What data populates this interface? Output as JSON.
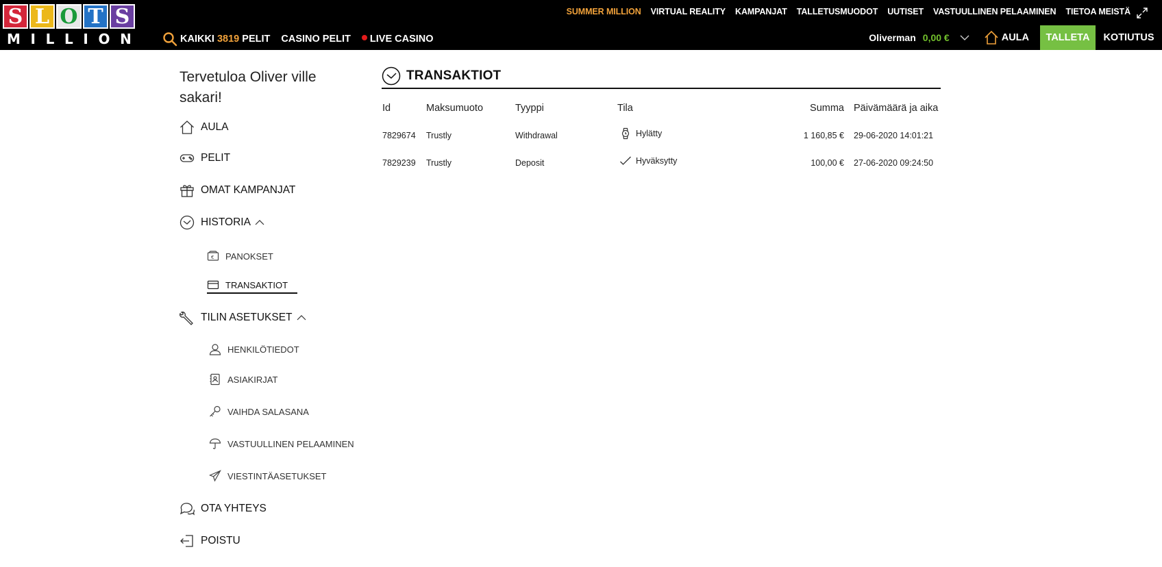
{
  "logo": {
    "tiles": [
      "S",
      "L",
      "O",
      "T",
      "S"
    ],
    "subtitle_letters": [
      "M",
      "I",
      "L",
      "L",
      "I",
      "O",
      "N"
    ]
  },
  "top_nav": {
    "items": [
      "SUMMER MILLION",
      "VIRTUAL REALITY",
      "KAMPANJAT",
      "TALLETUSMUODOT",
      "UUTISET",
      "VASTUULLINEN PELAAMINEN",
      "TIETOA MEISTÄ"
    ],
    "accent_color": "#f0a13a"
  },
  "main_nav": {
    "all_prefix": "KAIKKI",
    "game_count": "3819",
    "all_suffix": "PELIT",
    "casino": "CASINO PELIT",
    "live": "LIVE CASINO"
  },
  "account": {
    "username": "Oliverman",
    "balance": "0,00 €",
    "home_label": "AULA",
    "deposit_label": "TALLETA",
    "withdraw_label": "KOTIUTUS",
    "deposit_color": "#76c043"
  },
  "sidebar": {
    "welcome": "Tervetuloa Oliver ville sakari!",
    "items": {
      "aula": "AULA",
      "pelit": "PELIT",
      "kampanjat": "OMAT KAMPANJAT",
      "historia": "HISTORIA",
      "panokset": "PANOKSET",
      "transaktiot": "TRANSAKTIOT",
      "tilin": "TILIN ASETUKSET",
      "henkilotiedot": "HENKILÖTIEDOT",
      "asiakirjat": "ASIAKIRJAT",
      "salasana": "VAIHDA SALASANA",
      "vastuullinen": "VASTUULLINEN PELAAMINEN",
      "viestinta": "VIESTINTÄASETUKSET",
      "yhteys": "OTA YHTEYS",
      "poistu": "POISTU"
    }
  },
  "transactions": {
    "title": "TRANSAKTIOT",
    "headers": {
      "id": "Id",
      "method": "Maksumuoto",
      "type": "Tyyppi",
      "status": "Tila",
      "amount": "Summa",
      "datetime": "Päivämäärä ja aika"
    },
    "rows": [
      {
        "id": "7829674",
        "method": "Trustly",
        "type": "Withdrawal",
        "status": "Hylätty",
        "status_icon": "watch-icon",
        "amount": "1 160,85 €",
        "datetime": "29-06-2020 14:01:21"
      },
      {
        "id": "7829239",
        "method": "Trustly",
        "type": "Deposit",
        "status": "Hyväksytty",
        "status_icon": "check-icon",
        "amount": "100,00 €",
        "datetime": "27-06-2020 09:24:50"
      }
    ]
  }
}
